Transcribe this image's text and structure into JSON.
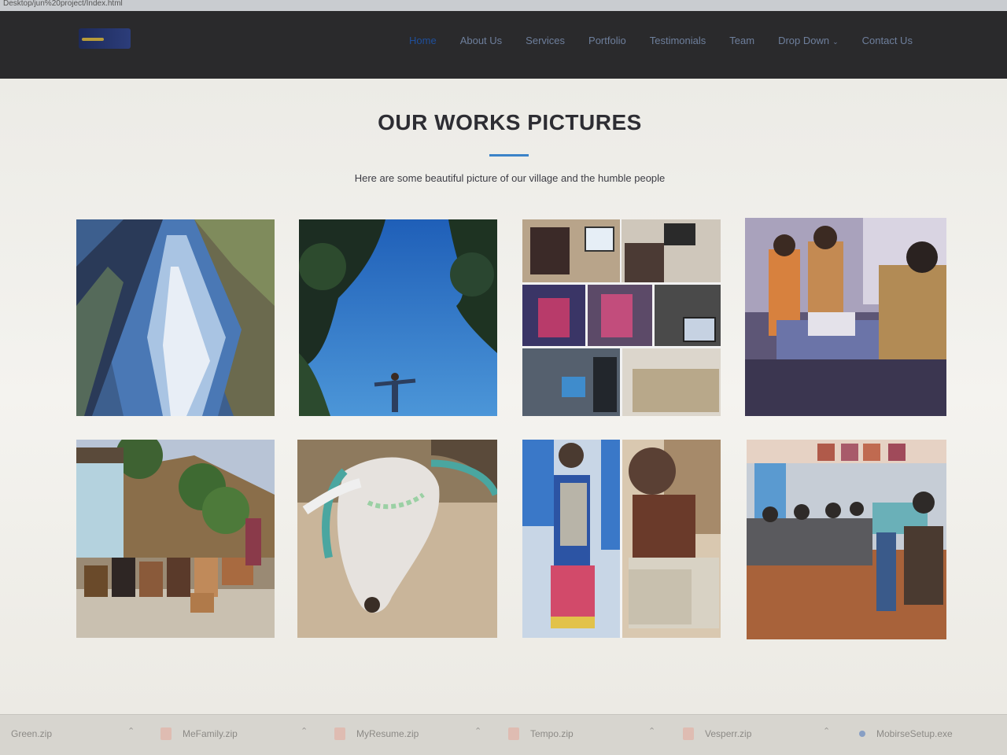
{
  "browser": {
    "url_fragment": "Desktop/jun%20project/Index.html"
  },
  "nav": {
    "items": [
      {
        "label": "Home",
        "active": true
      },
      {
        "label": "About Us"
      },
      {
        "label": "Services"
      },
      {
        "label": "Portfolio"
      },
      {
        "label": "Testimonials"
      },
      {
        "label": "Team"
      },
      {
        "label": "Drop Down",
        "has_caret": true
      },
      {
        "label": "Contact Us"
      }
    ]
  },
  "section": {
    "title": "OUR WORKS PICTURES",
    "subtitle": "Here are some beautiful picture of our village and the humble people"
  },
  "gallery": [
    {
      "id": "waterfall-photo"
    },
    {
      "id": "sky-person-photo"
    },
    {
      "id": "computer-lab-collage-photo"
    },
    {
      "id": "students-projector-photo"
    },
    {
      "id": "goats-herd-photo"
    },
    {
      "id": "cow-photo"
    },
    {
      "id": "girls-collage-photo"
    },
    {
      "id": "classroom-computers-photo"
    }
  ],
  "downloads": [
    {
      "name": "Green.zip"
    },
    {
      "name": "MeFamily.zip"
    },
    {
      "name": "MyResume.zip"
    },
    {
      "name": "Tempo.zip"
    },
    {
      "name": "Vesperr.zip"
    },
    {
      "name": "MobirseSetup.exe"
    }
  ],
  "colors": {
    "nav_bg": "#2a2a2c",
    "accent": "#3b83c8",
    "title": "#2d2d33"
  }
}
